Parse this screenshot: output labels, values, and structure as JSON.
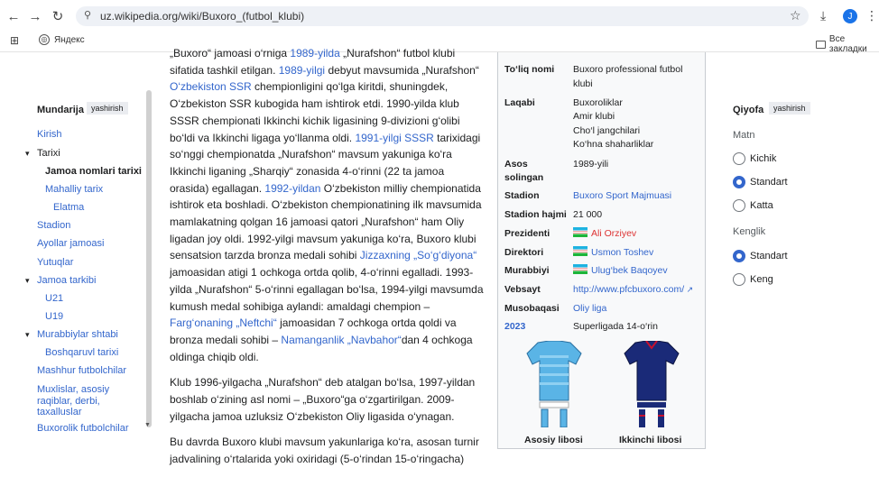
{
  "browser": {
    "url": "uz.wikipedia.org/wiki/Buxoro_(futbol_klubi)",
    "profile_initial": "J",
    "bookmark_yandex": "Яндекс",
    "bookmark_all": "Все закладки"
  },
  "toc": {
    "title": "Mundarija",
    "hide_label": "yashirish",
    "items": [
      {
        "label": "Kirish"
      },
      {
        "label": "Tarixi"
      },
      {
        "label": "Jamoa nomlari tarixi"
      },
      {
        "label": "Mahalliy tarix"
      },
      {
        "label": "Elatma"
      },
      {
        "label": "Stadion"
      },
      {
        "label": "Ayollar jamoasi"
      },
      {
        "label": "Yutuqlar"
      },
      {
        "label": "Jamoa tarkibi"
      },
      {
        "label": "U21"
      },
      {
        "label": "U19"
      },
      {
        "label": "Murabbiylar shtabi"
      },
      {
        "label": "Boshqaruvl tarixi"
      },
      {
        "label": "Mashhur futbolchilar"
      },
      {
        "label": "Muxlislar, asosiy"
      },
      {
        "label": "raqiblar, derbi,"
      },
      {
        "label": "taxalluslar"
      },
      {
        "label": "Buxorolik futbolchilar"
      }
    ]
  },
  "article": {
    "p1_top": "„Buxoro“ jamoasi o‘rniga ",
    "p1_link1": "1989-yilda",
    "p1_t1": " „Nurafshon“ futbol klubi sifatida tashkil etilgan. ",
    "p1_link2": "1989-yilgi",
    "p1_t2": " debyut mavsumida „Nurafshon“ ",
    "p1_link3": "O‘zbekiston SSR",
    "p1_t3": " chempionligini qo‘lga kiritdi, shuningdek, O‘zbekiston SSR kubogida ham ishtirok etdi. 1990-yilda klub SSSR chempionati Ikkinchi kichik ligasining 9-divizioni g‘olibi bo‘ldi va Ikkinchi ligaga yo‘llanma oldi. ",
    "p1_link4": "1991-yilgi SSSR",
    "p1_t4": " tarixidagi so‘nggi chempionatda „Nurafshon“ mavsum yakuniga ko‘ra Ikkinchi liganing „Sharqiy“ zonasida 4-o‘rinni (22 ta jamoa orasida) egallagan. ",
    "p1_link5": "1992-yildan",
    "p1_t5": " O‘zbekiston milliy chempionatida ishtirok eta boshladi. O‘zbekiston chempionatining ilk mavsumida mamlakatning qolgan 16 jamoasi qatori „Nurafshon“ ham Oliy ligadan joy oldi. 1992-yilgi mavsum yakuniga ko‘ra, Buxoro klubi sensatsion tarzda bronza medali sohibi ",
    "p1_link6": "Jizzaxning „So‘g‘diyona“",
    "p1_t6": " jamoasidan atigi 1 ochkoga ortda qolib, 4-o‘rinni egalladi. 1993-yilda „Nurafshon“ 5-o‘rinni egallagan bo‘lsa, 1994-yilgi mavsumda kumush medal sohibiga aylandi: amaldagi chempion – ",
    "p1_link7": "Farg‘onaning „Neftchi“",
    "p1_t7": " jamoasidan 7 ochkoga ortda qoldi va bronza medali sohibi – ",
    "p1_link8": "Namanganlik „Navbahor“",
    "p1_t8": "dan 4 ochkoga oldinga chiqib oldi.",
    "p2": "Klub 1996-yilgacha „Nurafshon“ deb atalgan bo‘lsa, 1997-yildan boshlab o‘zining asl nomi – „Buxoro“ga o‘zgartirilgan. 2009-yilgacha jamoa uzluksiz O‘zbekiston Oliy ligasida o‘ynagan.",
    "p3": "Bu davrda Buxoro klubi mavsum yakunlariga ko‘ra, asosan turnir jadvalining o‘rtalarida yoki oxiridagi (5-o‘rindan 15-o‘ringacha)"
  },
  "infobox": {
    "full_name_key": "To‘liq nomi",
    "full_name_val": "Buxoro professional futbol klubi",
    "nickname_key": "Laqabi",
    "nicknames": [
      "Buxoroliklar",
      "Amir klubi",
      "Cho‘l jangchilari",
      "Ko‘hna shaharliklar"
    ],
    "founded_key": "Asos solingan",
    "founded_val": "1989-yili",
    "stadium_key": "Stadion",
    "stadium_val": "Buxoro Sport Majmuasi",
    "capacity_key": "Stadion hajmi",
    "capacity_val": "21 000",
    "president_key": "Prezidenti",
    "president_val": "Ali Orziyev",
    "director_key": "Direktori",
    "director_val": "Usmon Toshev",
    "coach_key": "Murabbiyi",
    "coach_val": "Ulug‘bek Baqoyev",
    "website_key": "Vebsayt",
    "website_val": "http://www.pfcbuxoro.com/",
    "season_key": "Musobaqasi",
    "season_val": "Oliy liga",
    "year_key": "2023",
    "year_val": "Superligada 14-o‘rin",
    "kit_home": "Asosiy libosi",
    "kit_away": "Ikkinchi libosi",
    "colors": {
      "home_shirt": "#5ab4e6",
      "home_stripe": "#2f8fcf",
      "away_shirt": "#1a2a78",
      "away_trim": "#c8102e"
    }
  },
  "appearance": {
    "title": "Qiyofa",
    "hide_label": "yashirish",
    "text_section": "Matn",
    "text_options": [
      "Kichik",
      "Standart",
      "Katta"
    ],
    "width_section": "Kenglik",
    "width_options": [
      "Standart",
      "Keng"
    ]
  }
}
